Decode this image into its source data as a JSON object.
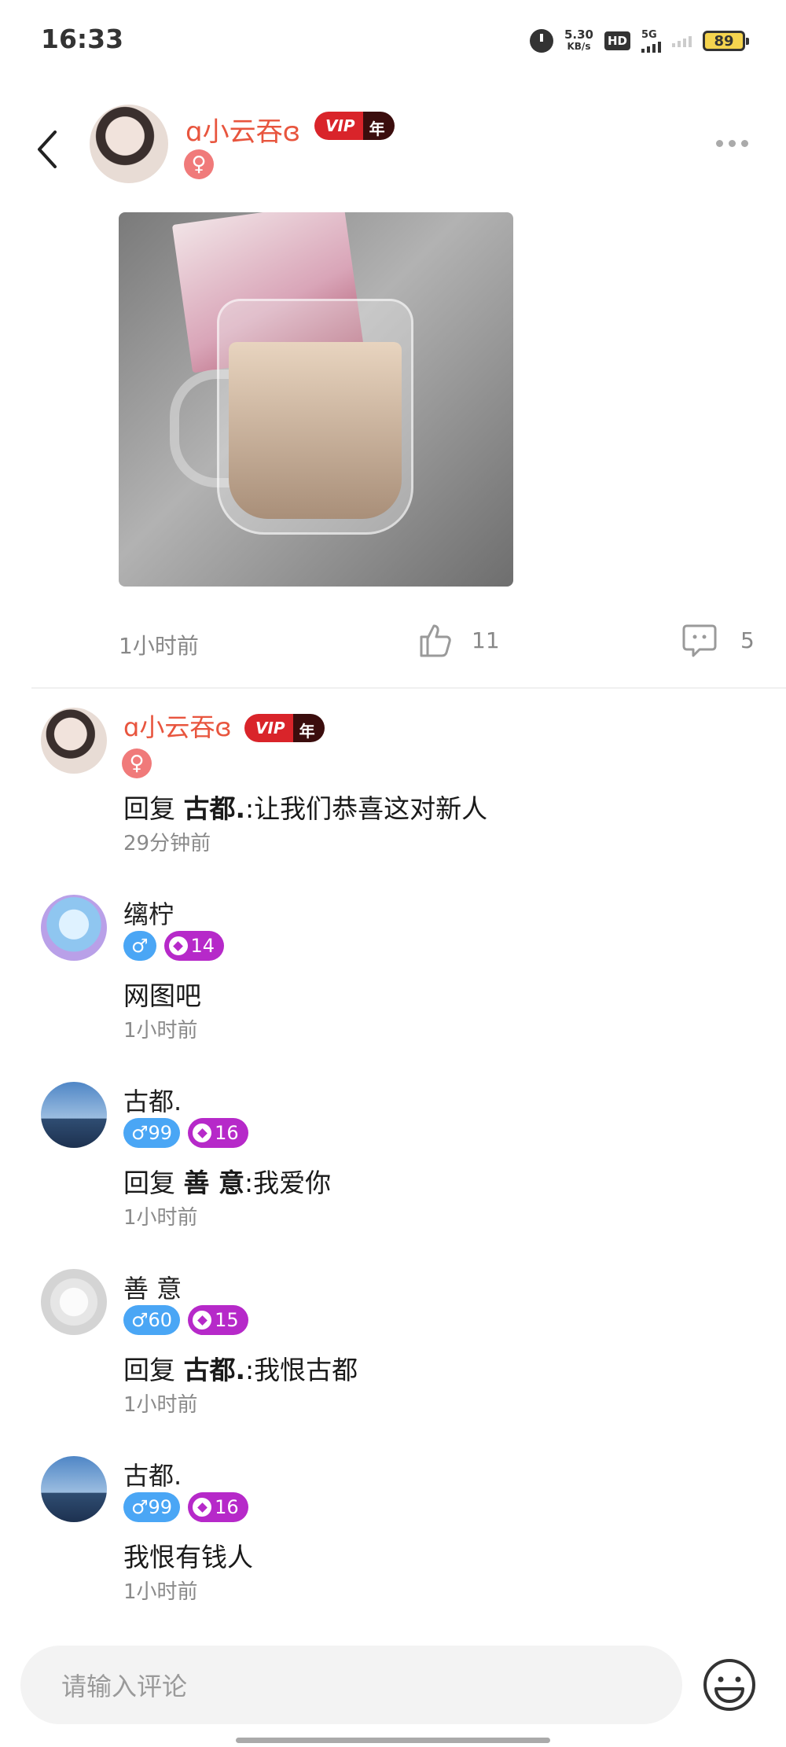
{
  "status_bar": {
    "time": "16:33",
    "net_speed_value": "5.30",
    "net_speed_unit": "KB/s",
    "hd_label": "HD",
    "network_label": "5G",
    "battery": "89"
  },
  "post": {
    "author_name": "ɑ小云吞ɞ",
    "vip_label": "VIP",
    "vip_period": "年",
    "gender_symbol": "♀",
    "time": "1小时前",
    "like_count": "11",
    "comment_count": "5",
    "image_alt": "coffee-milk-tea-photo"
  },
  "comments": [
    {
      "name": "ɑ小云吞ɞ",
      "vip": true,
      "vip_label": "VIP",
      "vip_period": "年",
      "gender": "♀",
      "reply_prefix": "回复",
      "reply_to": "古都.",
      "text": ":让我们恭喜这对新人",
      "time": "29分钟前"
    },
    {
      "name": "缡柠",
      "gender": "♂",
      "level": "14",
      "text": "网图吧",
      "time": "1小时前"
    },
    {
      "name": "古都.",
      "gender": "♂99",
      "level": "16",
      "reply_prefix": "回复",
      "reply_to": "善 意",
      "text": ":我爱你",
      "time": "1小时前"
    },
    {
      "name": "善 意",
      "gender": "♂60",
      "level": "15",
      "reply_prefix": "回复",
      "reply_to": "古都.",
      "text": ":我恨古都",
      "time": "1小时前"
    },
    {
      "name": "古都.",
      "gender": "♂99",
      "level": "16",
      "text": "我恨有钱人",
      "time": "1小时前"
    }
  ],
  "input": {
    "placeholder": "请输入评论"
  },
  "colors": {
    "vip_name": "#e8553e",
    "male_badge": "#4aa6f5",
    "female_badge": "#f07a7a",
    "level_badge": "#b629c9"
  }
}
